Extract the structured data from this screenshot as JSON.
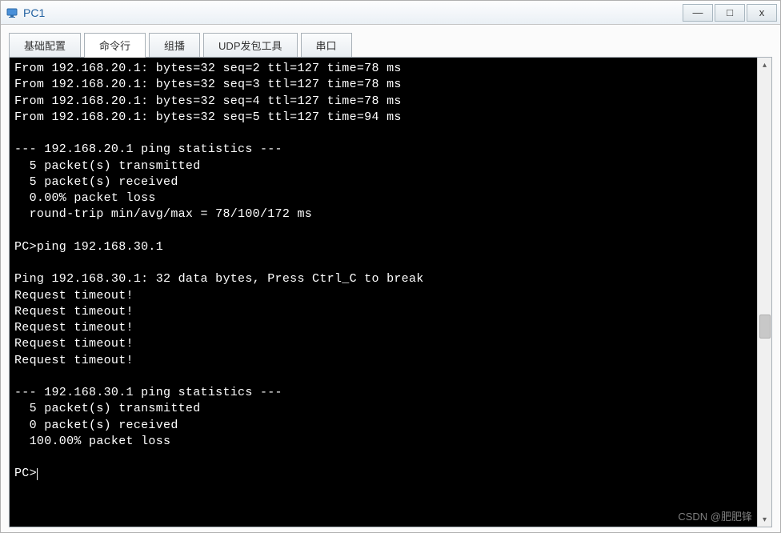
{
  "window": {
    "title": "PC1",
    "controls": {
      "minimize": "—",
      "maximize": "□",
      "close": "x"
    }
  },
  "tabs": [
    {
      "label": "基础配置",
      "active": false
    },
    {
      "label": "命令行",
      "active": true
    },
    {
      "label": "组播",
      "active": false
    },
    {
      "label": "UDP发包工具",
      "active": false
    },
    {
      "label": "串口",
      "active": false
    }
  ],
  "terminal": {
    "lines": [
      "From 192.168.20.1: bytes=32 seq=2 ttl=127 time=78 ms",
      "From 192.168.20.1: bytes=32 seq=3 ttl=127 time=78 ms",
      "From 192.168.20.1: bytes=32 seq=4 ttl=127 time=78 ms",
      "From 192.168.20.1: bytes=32 seq=5 ttl=127 time=94 ms",
      "",
      "--- 192.168.20.1 ping statistics ---",
      "  5 packet(s) transmitted",
      "  5 packet(s) received",
      "  0.00% packet loss",
      "  round-trip min/avg/max = 78/100/172 ms",
      "",
      "PC>ping 192.168.30.1",
      "",
      "Ping 192.168.30.1: 32 data bytes, Press Ctrl_C to break",
      "Request timeout!",
      "Request timeout!",
      "Request timeout!",
      "Request timeout!",
      "Request timeout!",
      "",
      "--- 192.168.30.1 ping statistics ---",
      "  5 packet(s) transmitted",
      "  0 packet(s) received",
      "  100.00% packet loss",
      "",
      "PC>"
    ]
  },
  "watermark": "CSDN @肥肥锋"
}
